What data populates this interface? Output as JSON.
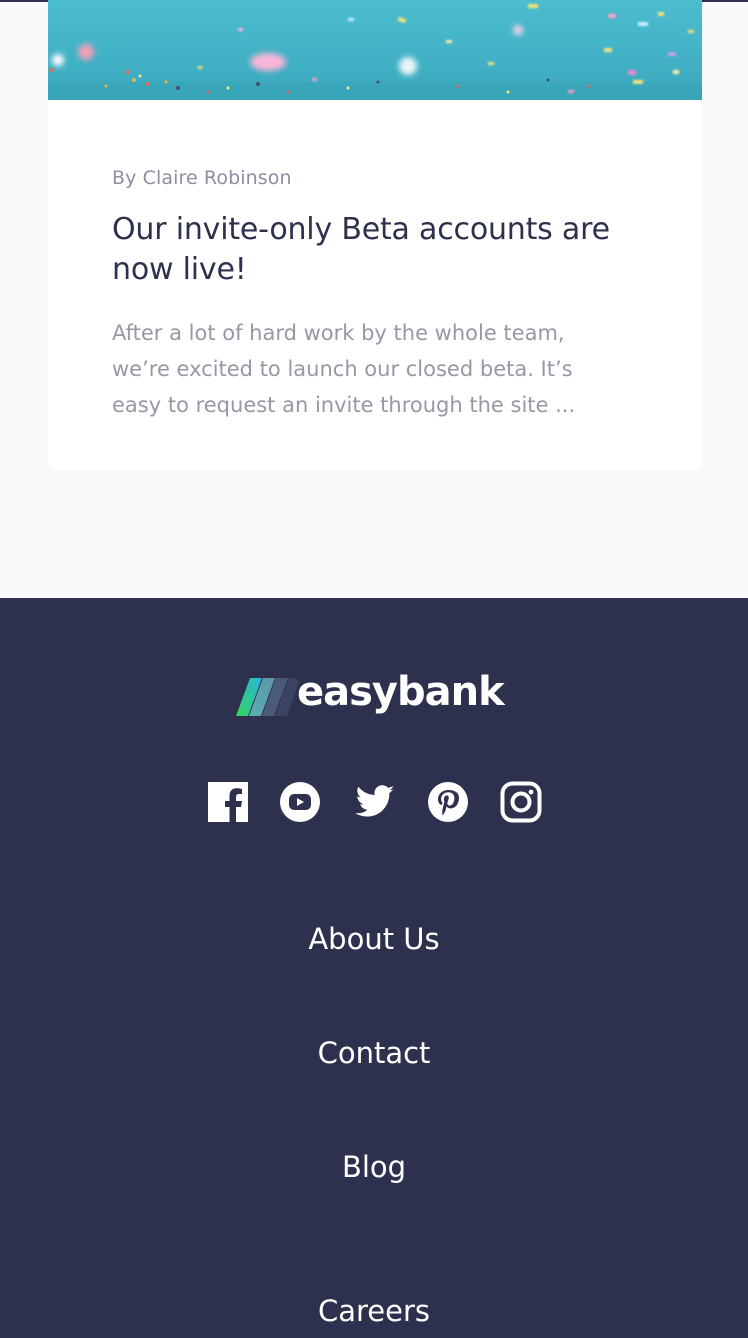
{
  "article": {
    "author": "By Claire Robinson",
    "title": "Our invite-only Beta accounts are now live!",
    "excerpt": "After a lot of hard work by the whole team, we’re excited to launch our closed beta. It’s easy to request an invite through the site ..."
  },
  "footer": {
    "logo_text": "easybank",
    "social_icons": [
      "facebook-icon",
      "youtube-icon",
      "twitter-icon",
      "pinterest-icon",
      "instagram-icon"
    ],
    "links": [
      "About Us",
      "Contact",
      "Blog",
      "Careers"
    ]
  },
  "colors": {
    "footer_background": "#2d314d",
    "page_background": "#fafafa",
    "title_text": "#2d314d",
    "muted_text": "#9698a6",
    "image_teal": "#41b4c8"
  }
}
